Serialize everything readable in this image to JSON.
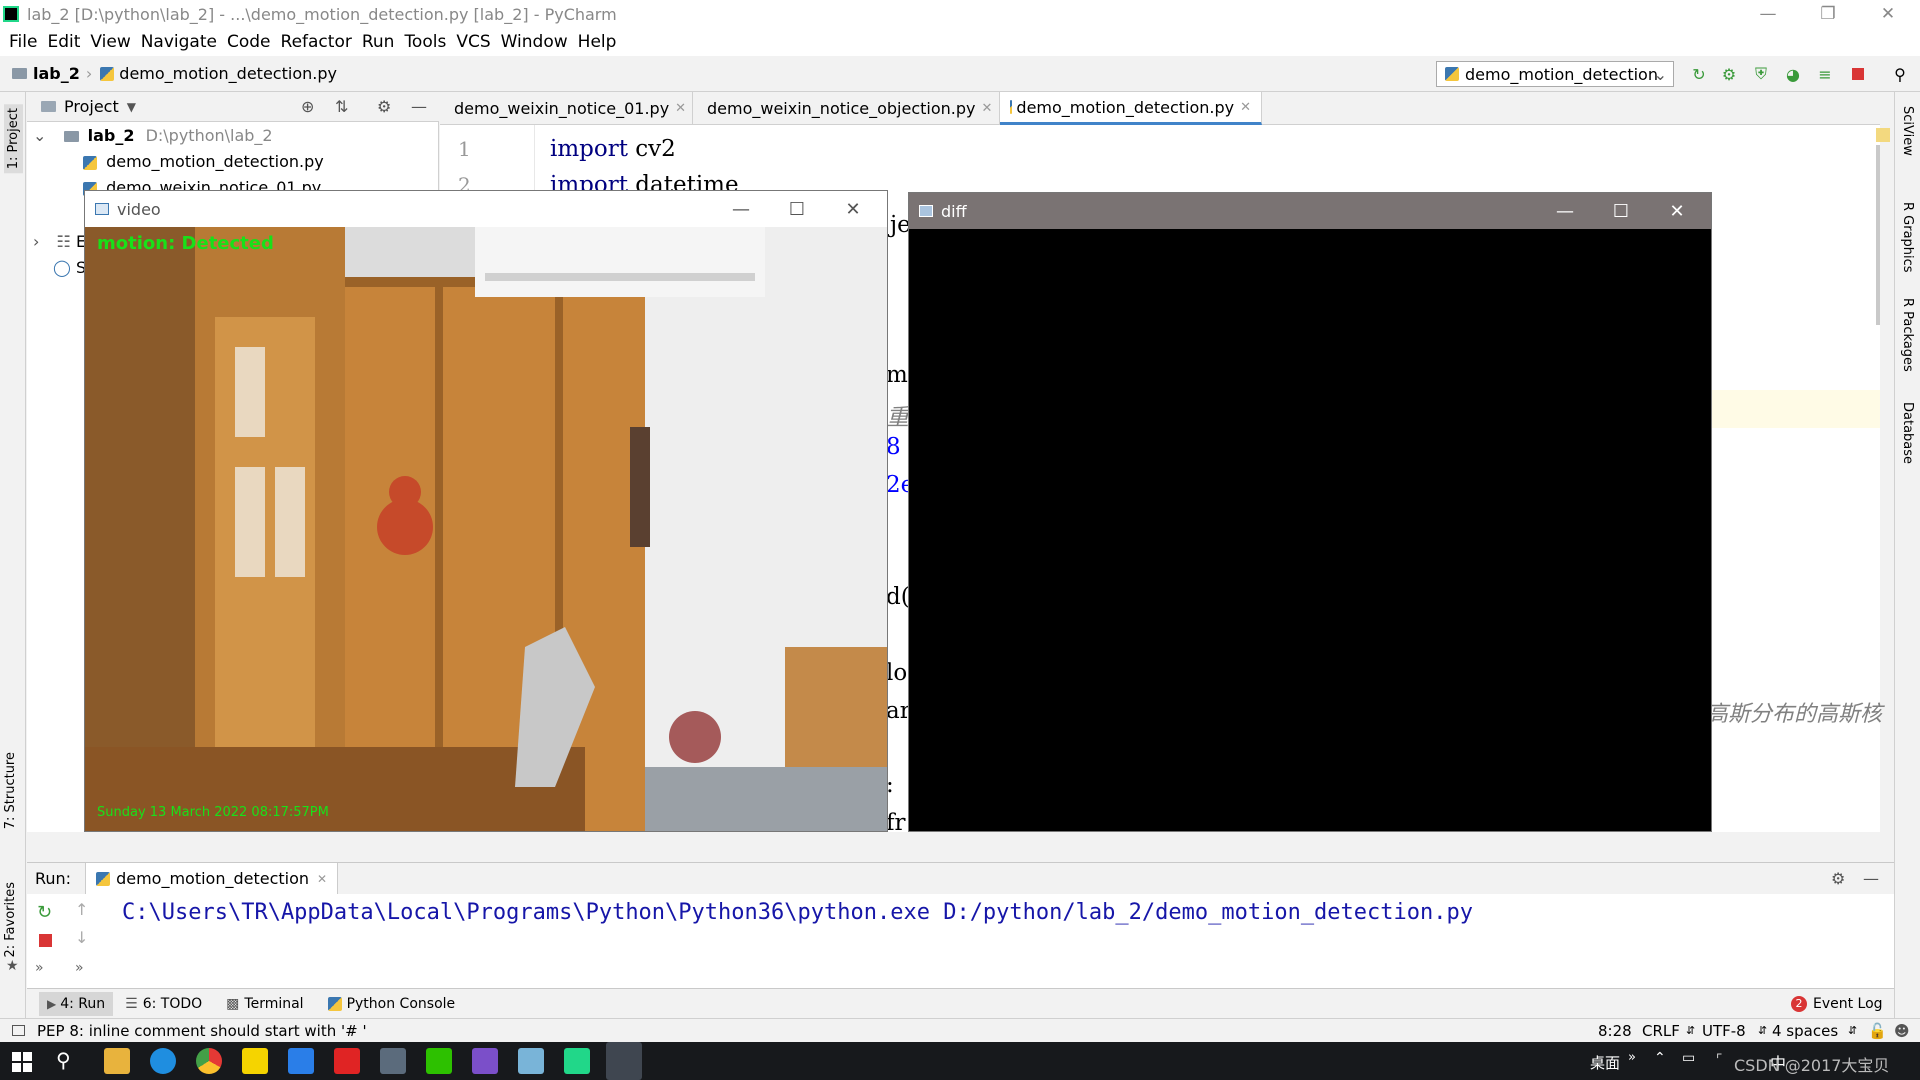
{
  "window": {
    "title": "lab_2 [D:\\python\\lab_2] - ...\\demo_motion_detection.py [lab_2] - PyCharm"
  },
  "menu": [
    "File",
    "Edit",
    "View",
    "Navigate",
    "Code",
    "Refactor",
    "Run",
    "Tools",
    "VCS",
    "Window",
    "Help"
  ],
  "breadcrumb": {
    "project": "lab_2",
    "file": "demo_motion_detection.py"
  },
  "run_config": "demo_motion_detection",
  "left_tabs": {
    "project": "1: Project",
    "structure": "7: Structure",
    "favorites": "2: Favorites"
  },
  "right_tabs": {
    "sciview": "SciView",
    "rgraphics": "R Graphics",
    "rpackages": "R Packages",
    "database": "Database"
  },
  "project_panel": {
    "title": "Project",
    "root_name": "lab_2",
    "root_path": "D:\\python\\lab_2",
    "files": [
      "demo_motion_detection.py",
      "demo_weixin_notice_01.py"
    ],
    "other_rows": [
      "E",
      "S"
    ]
  },
  "editor_tabs": [
    {
      "label": "demo_weixin_notice_01.py",
      "active": false
    },
    {
      "label": "demo_weixin_notice_objection.py",
      "active": false
    },
    {
      "label": "demo_motion_detection.py",
      "active": true
    }
  ],
  "code": {
    "line_numbers": [
      "1",
      "2"
    ],
    "line1_kw": "import",
    "line1_rest": "cv2",
    "line2_kw": "import",
    "line2_rest": "datetime",
    "frag_je": "je",
    "frag_me": "me",
    "frag_cn1": "重",
    "frag_8": "8",
    "frag_2e": "2e",
    "frag_d": "d(",
    "frag_lo": "lo",
    "frag_ar": "ar",
    "frag_colon": ":",
    "frag_fr": "fr",
    "comment_right": "高斯分布的高斯核"
  },
  "video_window": {
    "title": "video",
    "overlay_status": "motion: Detected",
    "timestamp": "Sunday 13 March 2022 08:17:57PM"
  },
  "diff_window": {
    "title": "diff"
  },
  "run_panel": {
    "label": "Run:",
    "tab": "demo_motion_detection",
    "command": "C:\\Users\\TR\\AppData\\Local\\Programs\\Python\\Python36\\python.exe D:/python/lab_2/demo_motion_detection.py"
  },
  "bottom_tabs": [
    {
      "label": "4: Run"
    },
    {
      "label": "6: TODO"
    },
    {
      "label": "Terminal"
    },
    {
      "label": "Python Console"
    }
  ],
  "event_log": {
    "count": "2",
    "label": "Event Log"
  },
  "status": {
    "message": "PEP 8: inline comment should start with '# '",
    "position": "8:28",
    "line_sep": "CRLF",
    "encoding": "UTF-8",
    "indent": "4 spaces"
  },
  "taskbar": {
    "desktop": "桌面",
    "tray_text": "CSDN @2017大宝贝",
    "ime": "中"
  },
  "colors": {
    "accent": "#4083c9",
    "motion_text": "#19e019",
    "run_green": "#3a9a3a",
    "stop_red": "#d93535"
  }
}
